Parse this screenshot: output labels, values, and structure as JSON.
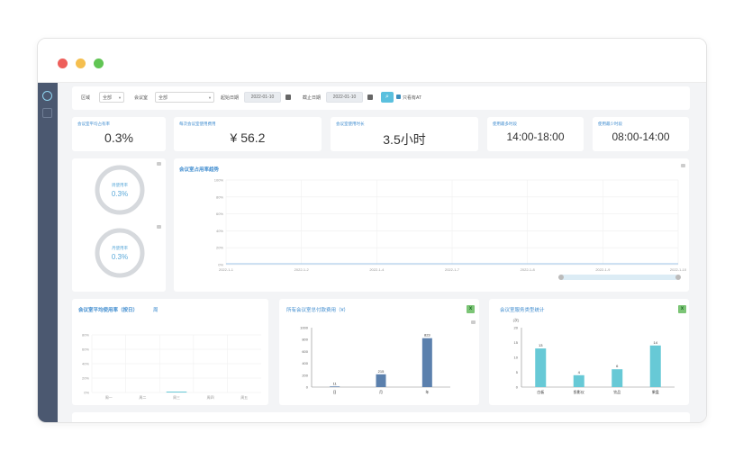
{
  "window": {
    "buttons": [
      "close",
      "minimize",
      "maximize"
    ]
  },
  "sidebar": {
    "items": [
      {
        "icon": "dashboard-icon"
      },
      {
        "icon": "document-icon"
      }
    ]
  },
  "filters": {
    "region_label": "区域",
    "region_value": "全部",
    "room_label": "会议室",
    "room_value": "全部",
    "start_label": "起始日期",
    "start_value": "2022-01-10",
    "end_label": "截止日期",
    "end_value": "2022-01-10",
    "search_icon": "search-icon",
    "checkbox_label": "只看有AT"
  },
  "stats": [
    {
      "label": "会议室平均占有率",
      "value": "0.3%"
    },
    {
      "label": "每次会议室使用费用",
      "value": "¥  56.2"
    },
    {
      "label": "会议室使用时长",
      "value": "3.5小时"
    },
    {
      "label": "使用最多时段",
      "value": "14:00-18:00"
    },
    {
      "label": "使用最少时段",
      "value": "08:00-14:00"
    }
  ],
  "donuts": [
    {
      "label": "周使用率",
      "value": "0.3%"
    },
    {
      "label": "月使用率",
      "value": "0.3%"
    }
  ],
  "colors": {
    "accent": "#3f8ccf",
    "bar_blue": "#5b80ad",
    "bar_teal": "#67c9d6",
    "sidebar": "#4b5870",
    "donut": "#d6d9dd"
  },
  "trend": {
    "title": "会议室占用率趋势",
    "y_ticks": [
      "100%",
      "80%",
      "60%",
      "40%",
      "20%",
      "0%"
    ],
    "x_ticks": [
      "2022-1-1",
      "2022-1-2",
      "2022-1-4",
      "2022-1-7",
      "2022-1-8",
      "2022-1-9",
      "2022-1-10"
    ]
  },
  "weekday": {
    "title": "会议室平均使用率（按日）",
    "filter": "周",
    "y_ticks": [
      "80%",
      "60%",
      "40%",
      "20%",
      "0%"
    ],
    "categories": [
      "周一",
      "周二",
      "周三",
      "周四",
      "周五"
    ]
  },
  "cost": {
    "title": "所有会议室总付款费用（¥）",
    "y_ticks": [
      "1000",
      "800",
      "600",
      "400",
      "200",
      "0"
    ],
    "categories": [
      "日",
      "月",
      "年"
    ],
    "values": [
      11,
      215,
      823
    ],
    "ylim": [
      0,
      1000
    ]
  },
  "service": {
    "title": "会议室服务类型统计",
    "y_ticks": [
      "20",
      "15",
      "10",
      "5",
      "0"
    ],
    "categories": [
      "白板",
      "投影仪",
      "饮品",
      "果盘"
    ],
    "values": [
      13,
      4,
      6,
      14
    ],
    "ylim": [
      0,
      20
    ],
    "y_unit": "(次)"
  }
}
